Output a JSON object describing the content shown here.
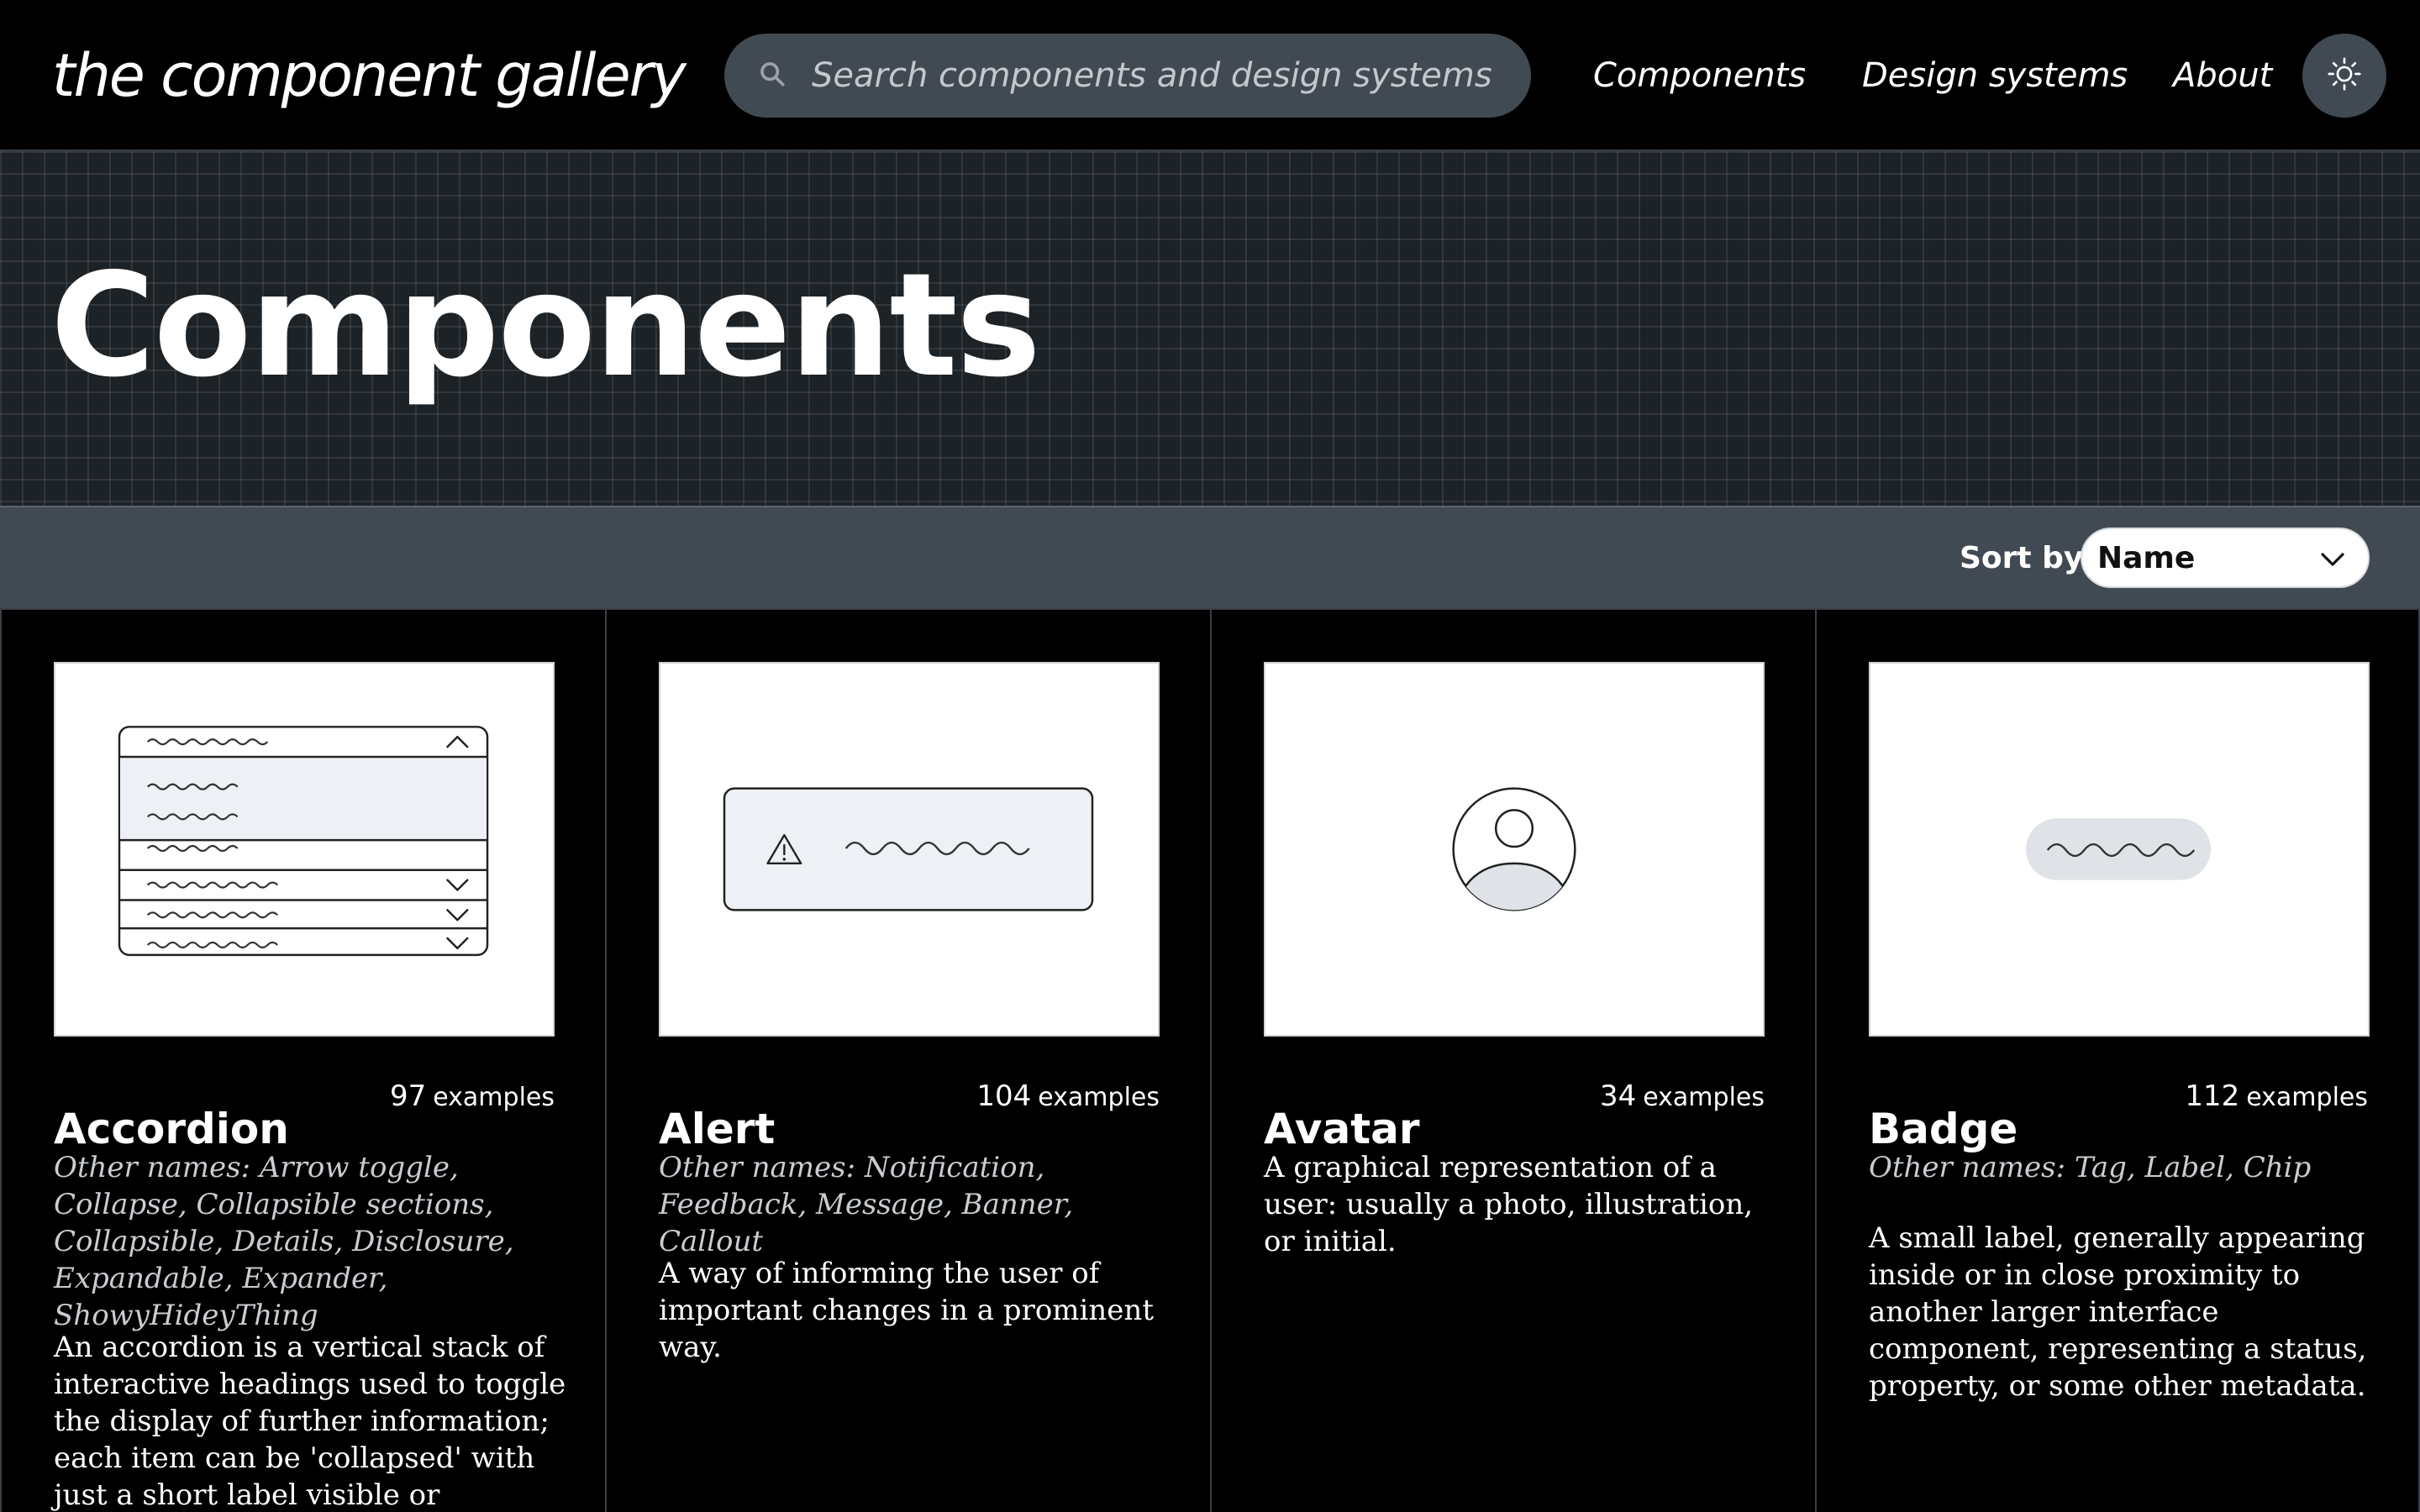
{
  "header": {
    "logo": "the component gallery",
    "search_placeholder": "Search components and design systems",
    "nav": {
      "components": "Components",
      "design_systems": "Design systems",
      "about": "About"
    }
  },
  "hero": {
    "title": "Components"
  },
  "sort": {
    "label": "Sort by",
    "selected": "Name"
  },
  "cards": [
    {
      "title": "Accordion",
      "count": "97",
      "count_word": "examples",
      "other_names": "Other names: Arrow toggle, Collapse, Collapsible sections, Collapsible, Details, Disclosure, Expandable, Expander, ShowyHideyThing",
      "description": "An accordion is a vertical stack of interactive headings used to toggle the display of further information; each item can be 'collapsed' with just a short label visible or 'expanded' to"
    },
    {
      "title": "Alert",
      "count": "104",
      "count_word": "examples",
      "other_names": "Other names: Notification, Feedback, Message, Banner, Callout",
      "description": "A way of informing the user of important changes in a prominent way."
    },
    {
      "title": "Avatar",
      "count": "34",
      "count_word": "examples",
      "other_names": "",
      "description": "A graphical representation of a user: usually a photo, illustration, or initial."
    },
    {
      "title": "Badge",
      "count": "112",
      "count_word": "examples",
      "other_names": "Other names: Tag, Label, Chip",
      "description": "A small label, generally appearing inside or in close proximity to another larger interface component, representing a status, property, or some other metadata."
    }
  ]
}
